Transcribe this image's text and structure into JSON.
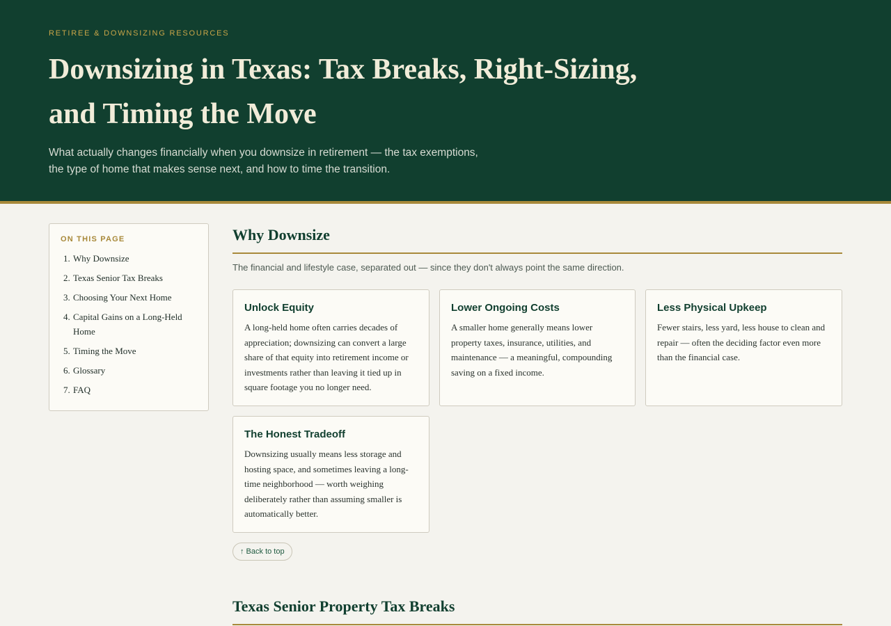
{
  "hero": {
    "eyebrow": "RETIREE & DOWNSIZING RESOURCES",
    "title": "Downsizing in Texas: Tax Breaks, Right-Sizing, and Timing the Move",
    "lede": "What actually changes financially when you downsize in retirement — the tax exemptions, the type of home that makes sense next, and how to time the transition."
  },
  "toc": {
    "title": "ON THIS PAGE",
    "items": [
      {
        "num": "1.",
        "label": "Why Downsize"
      },
      {
        "num": "2.",
        "label": "Texas Senior Tax Breaks"
      },
      {
        "num": "3.",
        "label": "Choosing Your Next Home"
      },
      {
        "num": "4.",
        "label": "Capital Gains on a Long-Held Home"
      },
      {
        "num": "5.",
        "label": "Timing the Move"
      },
      {
        "num": "6.",
        "label": "Glossary"
      },
      {
        "num": "7.",
        "label": "FAQ"
      }
    ]
  },
  "section1": {
    "title": "Why Downsize",
    "subtitle": "The financial and lifestyle case, separated out — since they don't always point the same direction.",
    "cards": [
      {
        "title": "Unlock Equity",
        "body": "A long-held home often carries decades of appreciation; downsizing can convert a large share of that equity into retirement income or investments rather than leaving it tied up in square footage you no longer need."
      },
      {
        "title": "Lower Ongoing Costs",
        "body": "A smaller home generally means lower property taxes, insurance, utilities, and maintenance — a meaningful, compounding saving on a fixed income."
      },
      {
        "title": "Less Physical Upkeep",
        "body": "Fewer stairs, less yard, less house to clean and repair — often the deciding factor even more than the financial case."
      },
      {
        "title": "The Honest Tradeoff",
        "body": "Downsizing usually means less storage and hosting space, and sometimes leaving a long-time neighborhood — worth weighing deliberately rather than assuming smaller is automatically better."
      }
    ],
    "back_to_top": "↑ Back to top"
  },
  "section2": {
    "title": "Texas Senior Property Tax Breaks"
  }
}
